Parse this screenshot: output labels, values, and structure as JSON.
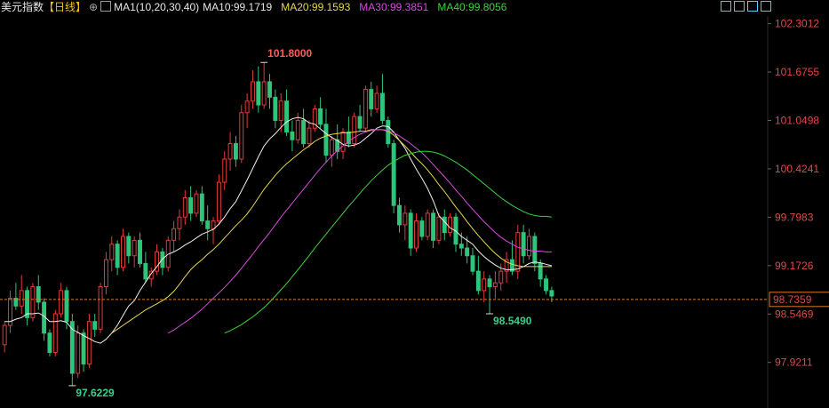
{
  "header": {
    "instrument": "美元指数",
    "period": "【日线】",
    "add_symbol": "⊕",
    "ma_label": "MA1(10,20,30,40)",
    "ma10": "MA10:99.1719",
    "ma20": "MA20:99.1593",
    "ma30": "MA30:99.3851",
    "ma40": "MA40:99.8056"
  },
  "toolbar": {
    "icons": [
      "grid-icon",
      "layout-icon",
      "screenshot-icon",
      "fullscreen-icon"
    ]
  },
  "colors": {
    "background": "#000000",
    "up": "#e43a3a",
    "down": "#2ec47a",
    "ma10": "#f0f0f0",
    "ma20": "#e6d84a",
    "ma30": "#d84ad8",
    "ma40": "#3ad43a",
    "axis_text": "#e04848",
    "price_line": "#e07a20",
    "high_label": "#ff5a5a",
    "low_label": "#3ad08a"
  },
  "chart_data": {
    "type": "candlestick",
    "price_axis_ticks": [
      "102.3012",
      "101.6755",
      "101.0498",
      "100.4241",
      "99.7983",
      "99.1726",
      "98.5469",
      "97.9211"
    ],
    "ylim": [
      97.55,
      102.4
    ],
    "current_price": "98.7359",
    "high_annotation": {
      "label": "101.8000",
      "index": 46
    },
    "low_annotation": {
      "label": "98.5490",
      "index": 86
    },
    "low_annotation_2": {
      "label": "97.6229",
      "index": 12
    },
    "candles": [
      [
        98.15,
        98.45,
        98.05,
        98.4
      ],
      [
        98.4,
        98.85,
        98.3,
        98.75
      ],
      [
        98.75,
        98.95,
        98.6,
        98.65
      ],
      [
        98.65,
        99.05,
        98.55,
        98.85
      ],
      [
        98.85,
        98.9,
        98.4,
        98.5
      ],
      [
        98.5,
        98.95,
        98.45,
        98.9
      ],
      [
        98.9,
        99.05,
        98.6,
        98.7
      ],
      [
        98.7,
        98.75,
        98.2,
        98.3
      ],
      [
        98.3,
        98.35,
        98.0,
        98.05
      ],
      [
        98.05,
        98.6,
        98.0,
        98.55
      ],
      [
        98.55,
        98.95,
        98.5,
        98.85
      ],
      [
        98.85,
        98.9,
        98.35,
        98.45
      ],
      [
        98.45,
        98.55,
        97.62,
        97.78
      ],
      [
        97.78,
        98.4,
        97.72,
        98.3
      ],
      [
        98.3,
        98.35,
        97.8,
        97.9
      ],
      [
        97.9,
        98.55,
        97.85,
        98.45
      ],
      [
        98.45,
        98.55,
        98.25,
        98.35
      ],
      [
        98.35,
        98.95,
        98.3,
        98.9
      ],
      [
        98.9,
        99.35,
        98.8,
        99.25
      ],
      [
        99.25,
        99.55,
        99.1,
        99.45
      ],
      [
        99.45,
        99.5,
        99.05,
        99.15
      ],
      [
        99.15,
        99.65,
        99.1,
        99.55
      ],
      [
        99.55,
        99.6,
        99.2,
        99.3
      ],
      [
        99.3,
        99.55,
        99.15,
        99.5
      ],
      [
        99.5,
        99.6,
        99.15,
        99.2
      ],
      [
        99.2,
        99.35,
        98.95,
        99.0
      ],
      [
        99.0,
        99.15,
        98.9,
        99.1
      ],
      [
        99.1,
        99.45,
        99.05,
        99.35
      ],
      [
        99.35,
        99.4,
        99.05,
        99.15
      ],
      [
        99.15,
        99.55,
        99.1,
        99.5
      ],
      [
        99.5,
        99.75,
        99.35,
        99.65
      ],
      [
        99.65,
        99.9,
        99.5,
        99.8
      ],
      [
        99.8,
        100.15,
        99.7,
        100.05
      ],
      [
        100.05,
        100.2,
        99.75,
        99.85
      ],
      [
        99.85,
        100.15,
        99.8,
        100.1
      ],
      [
        100.1,
        100.2,
        99.7,
        99.75
      ],
      [
        99.75,
        99.95,
        99.5,
        99.65
      ],
      [
        99.65,
        99.8,
        99.45,
        99.75
      ],
      [
        99.75,
        100.35,
        99.7,
        100.25
      ],
      [
        100.25,
        100.65,
        100.15,
        100.55
      ],
      [
        100.55,
        100.9,
        100.4,
        100.75
      ],
      [
        100.75,
        100.85,
        100.45,
        100.55
      ],
      [
        100.55,
        101.25,
        100.5,
        101.15
      ],
      [
        101.15,
        101.4,
        100.95,
        101.3
      ],
      [
        101.3,
        101.7,
        101.2,
        101.55
      ],
      [
        101.55,
        101.75,
        101.15,
        101.25
      ],
      [
        101.25,
        101.8,
        101.2,
        101.55
      ],
      [
        101.55,
        101.65,
        101.2,
        101.35
      ],
      [
        101.35,
        101.45,
        100.95,
        101.05
      ],
      [
        101.05,
        101.4,
        100.9,
        101.3
      ],
      [
        101.3,
        101.45,
        100.85,
        100.9
      ],
      [
        100.9,
        101.05,
        100.65,
        100.8
      ],
      [
        100.8,
        101.15,
        100.75,
        101.05
      ],
      [
        101.05,
        101.2,
        100.7,
        100.75
      ],
      [
        100.75,
        101.05,
        100.7,
        100.95
      ],
      [
        100.95,
        101.25,
        100.9,
        101.2
      ],
      [
        101.2,
        101.35,
        100.95,
        101.0
      ],
      [
        101.0,
        101.2,
        100.5,
        100.6
      ],
      [
        100.6,
        100.85,
        100.45,
        100.8
      ],
      [
        100.8,
        101.0,
        100.55,
        100.65
      ],
      [
        100.65,
        100.95,
        100.55,
        100.9
      ],
      [
        100.9,
        101.1,
        100.7,
        100.75
      ],
      [
        100.75,
        101.15,
        100.7,
        101.1
      ],
      [
        101.1,
        101.25,
        100.9,
        100.95
      ],
      [
        100.95,
        101.5,
        100.9,
        101.45
      ],
      [
        101.45,
        101.55,
        101.1,
        101.2
      ],
      [
        101.2,
        101.5,
        101.15,
        101.4
      ],
      [
        101.4,
        101.65,
        101.0,
        101.05
      ],
      [
        101.05,
        101.1,
        100.7,
        100.75
      ],
      [
        100.75,
        100.8,
        99.85,
        99.95
      ],
      [
        99.95,
        100.05,
        99.6,
        99.7
      ],
      [
        99.7,
        99.95,
        99.5,
        99.85
      ],
      [
        99.85,
        99.9,
        99.3,
        99.4
      ],
      [
        99.4,
        99.85,
        99.35,
        99.75
      ],
      [
        99.75,
        99.8,
        99.5,
        99.55
      ],
      [
        99.55,
        99.9,
        99.5,
        99.85
      ],
      [
        99.85,
        99.9,
        99.4,
        99.5
      ],
      [
        99.5,
        99.85,
        99.45,
        99.8
      ],
      [
        99.8,
        99.9,
        99.5,
        99.6
      ],
      [
        99.6,
        99.85,
        99.55,
        99.8
      ],
      [
        99.8,
        99.85,
        99.35,
        99.45
      ],
      [
        99.45,
        99.6,
        99.3,
        99.4
      ],
      [
        99.4,
        99.55,
        99.2,
        99.3
      ],
      [
        99.3,
        99.4,
        99.05,
        99.1
      ],
      [
        99.1,
        99.3,
        98.8,
        98.85
      ],
      [
        98.85,
        99.1,
        98.7,
        99.0
      ],
      [
        99.0,
        99.05,
        98.55,
        98.9
      ],
      [
        98.9,
        99.1,
        98.75,
        98.95
      ],
      [
        98.95,
        99.2,
        98.85,
        99.1
      ],
      [
        99.1,
        99.35,
        98.95,
        99.25
      ],
      [
        99.25,
        99.5,
        99.05,
        99.1
      ],
      [
        99.1,
        99.7,
        99.0,
        99.6
      ],
      [
        99.6,
        99.7,
        99.2,
        99.3
      ],
      [
        99.3,
        99.65,
        99.25,
        99.55
      ],
      [
        99.55,
        99.6,
        99.1,
        99.2
      ],
      [
        99.2,
        99.25,
        98.9,
        99.0
      ],
      [
        99.0,
        99.05,
        98.8,
        98.85
      ],
      [
        98.85,
        98.9,
        98.7,
        98.78
      ]
    ],
    "ma10": [
      98.45,
      98.45,
      98.48,
      98.5,
      98.55,
      98.55,
      98.56,
      98.52,
      98.45,
      98.45,
      98.46,
      98.44,
      98.35,
      98.31,
      98.27,
      98.23,
      98.19,
      98.17,
      98.22,
      98.3,
      98.4,
      98.53,
      98.65,
      98.72,
      98.85,
      98.96,
      99.07,
      99.16,
      99.26,
      99.32,
      99.35,
      99.39,
      99.44,
      99.48,
      99.53,
      99.58,
      99.61,
      99.64,
      99.71,
      99.8,
      99.91,
      100.0,
      100.14,
      100.28,
      100.43,
      100.58,
      100.72,
      100.81,
      100.88,
      100.96,
      101.03,
      101.07,
      101.09,
      101.07,
      101.02,
      101.0,
      100.94,
      100.88,
      100.83,
      100.79,
      100.74,
      100.72,
      100.73,
      100.76,
      100.82,
      100.88,
      100.95,
      100.98,
      100.97,
      100.9,
      100.79,
      100.69,
      100.55,
      100.42,
      100.3,
      100.17,
      100.01,
      99.82,
      99.74,
      99.66,
      99.62,
      99.55,
      99.5,
      99.45,
      99.36,
      99.29,
      99.23,
      99.18,
      99.14,
      99.12,
      99.12,
      99.13,
      99.16,
      99.2,
      99.22,
      99.21,
      99.19,
      99.17
    ],
    "ma20": [
      null,
      null,
      null,
      null,
      null,
      null,
      null,
      null,
      null,
      null,
      null,
      null,
      null,
      null,
      null,
      null,
      null,
      null,
      null,
      98.3,
      98.35,
      98.4,
      98.45,
      98.5,
      98.55,
      98.6,
      98.64,
      98.68,
      98.72,
      98.77,
      98.84,
      98.93,
      99.03,
      99.12,
      99.19,
      99.25,
      99.32,
      99.38,
      99.45,
      99.53,
      99.61,
      99.69,
      99.76,
      99.84,
      99.94,
      100.05,
      100.16,
      100.25,
      100.34,
      100.42,
      100.49,
      100.55,
      100.61,
      100.67,
      100.72,
      100.78,
      100.82,
      100.85,
      100.87,
      100.88,
      100.89,
      100.89,
      100.9,
      100.91,
      100.91,
      100.93,
      100.93,
      100.93,
      100.91,
      100.86,
      100.79,
      100.72,
      100.64,
      100.56,
      100.49,
      100.41,
      100.32,
      100.22,
      100.13,
      100.03,
      99.93,
      99.84,
      99.74,
      99.65,
      99.56,
      99.48,
      99.4,
      99.33,
      99.27,
      99.22,
      99.19,
      99.17,
      99.16,
      99.16,
      99.16,
      99.16,
      99.16,
      99.16
    ],
    "ma30": [
      null,
      null,
      null,
      null,
      null,
      null,
      null,
      null,
      null,
      null,
      null,
      null,
      null,
      null,
      null,
      null,
      null,
      null,
      null,
      null,
      null,
      null,
      null,
      null,
      null,
      null,
      null,
      null,
      null,
      98.3,
      98.34,
      98.39,
      98.44,
      98.49,
      98.55,
      98.61,
      98.68,
      98.75,
      98.82,
      98.89,
      98.97,
      99.05,
      99.14,
      99.23,
      99.32,
      99.42,
      99.51,
      99.6,
      99.7,
      99.8,
      99.89,
      99.98,
      100.07,
      100.16,
      100.25,
      100.34,
      100.43,
      100.51,
      100.59,
      100.66,
      100.72,
      100.78,
      100.83,
      100.87,
      100.9,
      100.92,
      100.93,
      100.93,
      100.92,
      100.89,
      100.85,
      100.8,
      100.75,
      100.69,
      100.63,
      100.56,
      100.48,
      100.4,
      100.32,
      100.24,
      100.15,
      100.07,
      99.98,
      99.9,
      99.82,
      99.74,
      99.67,
      99.6,
      99.54,
      99.49,
      99.45,
      99.41,
      99.39,
      99.37,
      99.36,
      99.36,
      99.35,
      99.35
    ],
    "ma40": [
      null,
      null,
      null,
      null,
      null,
      null,
      null,
      null,
      null,
      null,
      null,
      null,
      null,
      null,
      null,
      null,
      null,
      null,
      null,
      null,
      null,
      null,
      null,
      null,
      null,
      null,
      null,
      null,
      null,
      null,
      null,
      null,
      null,
      null,
      null,
      null,
      null,
      null,
      null,
      98.3,
      98.33,
      98.37,
      98.41,
      98.46,
      98.51,
      98.57,
      98.63,
      98.7,
      98.78,
      98.86,
      98.94,
      99.03,
      99.12,
      99.21,
      99.3,
      99.4,
      99.49,
      99.58,
      99.67,
      99.76,
      99.85,
      99.94,
      100.02,
      100.11,
      100.19,
      100.27,
      100.34,
      100.41,
      100.47,
      100.52,
      100.56,
      100.6,
      100.62,
      100.64,
      100.65,
      100.65,
      100.64,
      100.62,
      100.59,
      100.55,
      100.51,
      100.46,
      100.41,
      100.35,
      100.29,
      100.23,
      100.17,
      100.11,
      100.05,
      100.0,
      99.95,
      99.91,
      99.87,
      99.84,
      99.82,
      99.81,
      99.81,
      99.8
    ]
  }
}
